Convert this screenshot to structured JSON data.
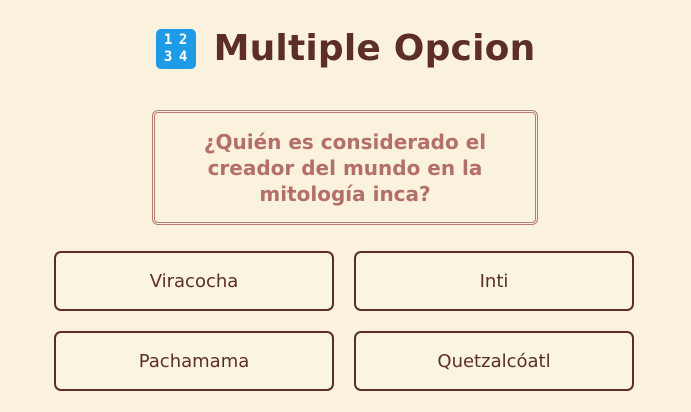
{
  "header": {
    "icon": "input-numbers-icon",
    "icon_digits": [
      "1",
      "2",
      "3",
      "4"
    ],
    "title": "Multiple Opcion"
  },
  "question": {
    "text": "¿Quién es considerado el creador del mundo en la mitología inca?"
  },
  "options": [
    {
      "label": "Viracocha"
    },
    {
      "label": "Inti"
    },
    {
      "label": "Pachamama"
    },
    {
      "label": "Quetzalcóatl"
    }
  ],
  "colors": {
    "background": "#faf2dc",
    "title": "#5c2e27",
    "question_text": "#b46f69",
    "question_border": "#b77a73",
    "option_border": "#5c2e27",
    "icon_bg": "#1e9be6"
  }
}
